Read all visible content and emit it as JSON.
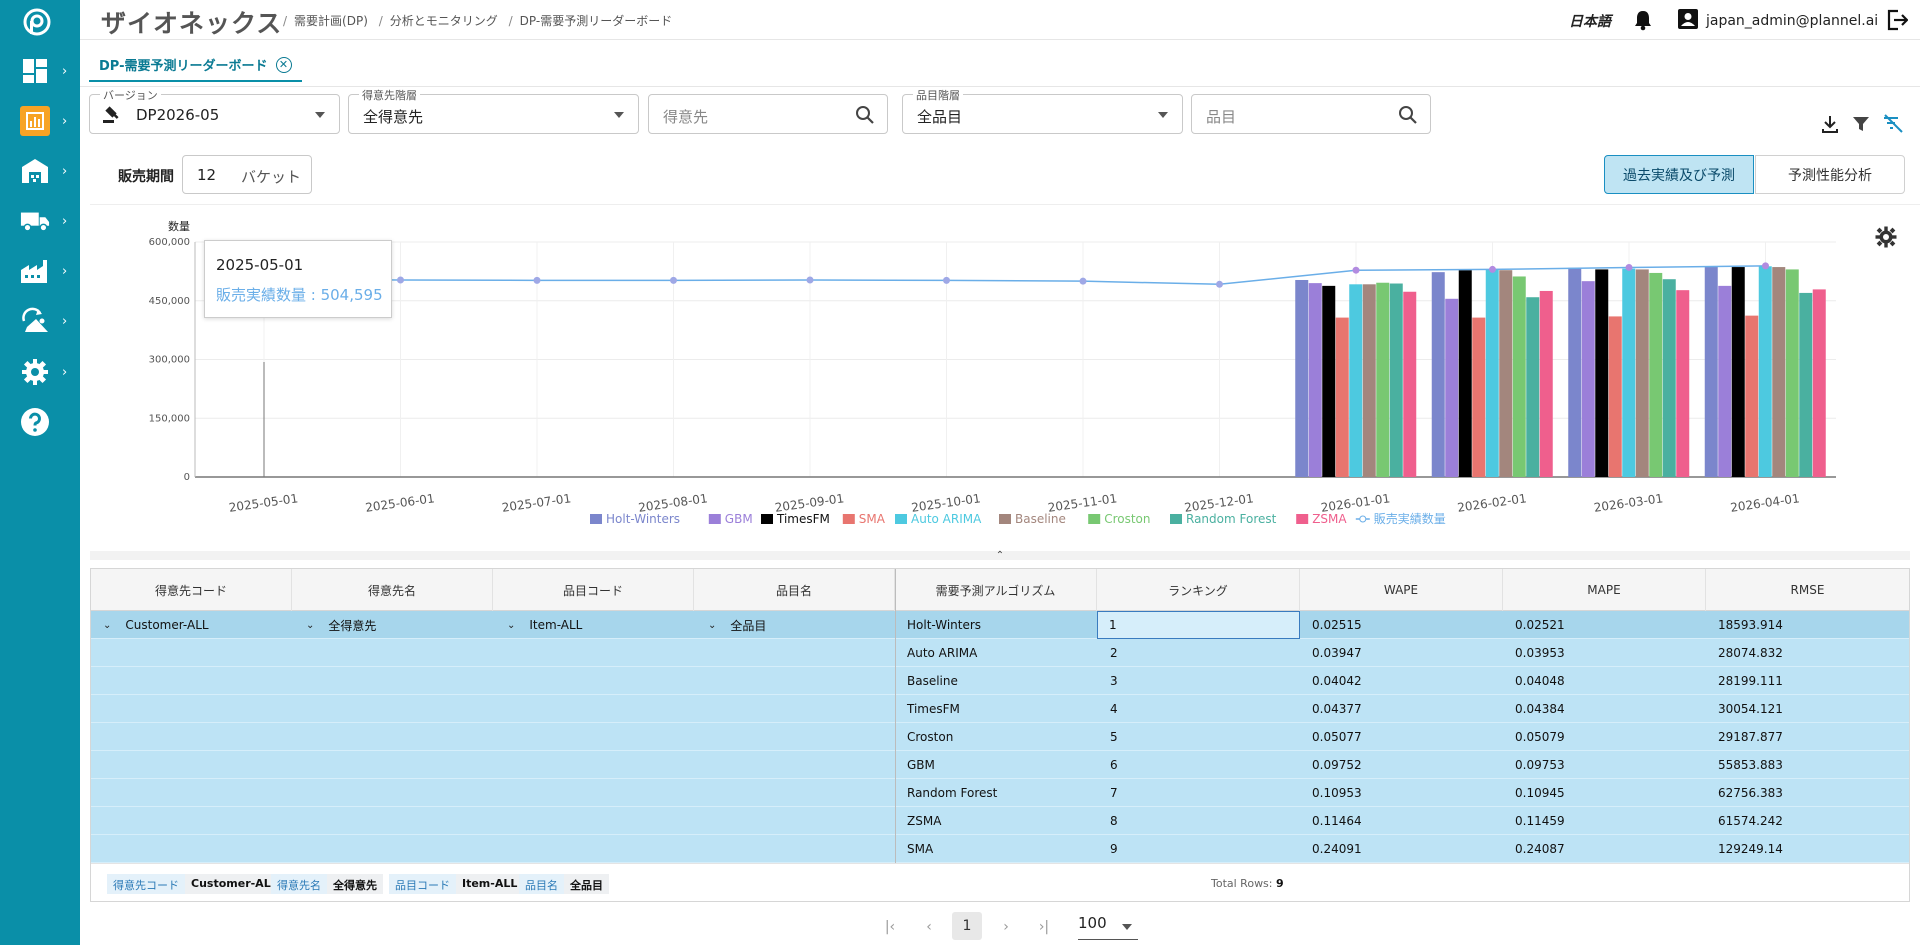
{
  "app": {
    "brand": "ザイオネックス",
    "breadcrumbs": [
      "需要計画(DP)",
      "分析とモニタリング",
      "DP-需要予測リーダーボード"
    ],
    "language": "日本語",
    "user_email": "japan_admin@plannel.ai"
  },
  "tab": {
    "label": "DP-需要予測リーダーボード"
  },
  "filters": {
    "version": {
      "label": "バージョン",
      "value": "DP2026-05"
    },
    "customer_level": {
      "label": "得意先階層",
      "value": "全得意先"
    },
    "customer_search": {
      "placeholder": "得意先"
    },
    "item_level": {
      "label": "品目階層",
      "value": "全品目"
    },
    "item_search": {
      "placeholder": "品目"
    }
  },
  "period": {
    "label": "販売期間",
    "value": "12",
    "unit": "バケット"
  },
  "toggles": {
    "history": "過去実績及び予測",
    "performance": "予測性能分析"
  },
  "tooltip": {
    "date": "2025-05-01",
    "label": "販売実績数量 : 504,595"
  },
  "colors": {
    "sidebar": "#0a8fa8",
    "active_nav": "#f7a325",
    "row_selected": "#a7d6ec",
    "row": "#bde3f5",
    "toggle_on": "#bfe4f3"
  },
  "chart_data": {
    "type": "bar",
    "ylabel": "数量",
    "ylim": [
      0,
      600000
    ],
    "yticks": [
      "0",
      "150,000",
      "300,000",
      "450,000",
      "600,000"
    ],
    "x": [
      "2025-05-01",
      "2025-06-01",
      "2025-07-01",
      "2025-08-01",
      "2025-09-01",
      "2025-10-01",
      "2025-11-01",
      "2025-12-01",
      "2026-01-01",
      "2026-02-01",
      "2026-03-01",
      "2026-04-01"
    ],
    "series": [
      {
        "name": "Holt-Winters",
        "color": "#7b86cc",
        "values": [
          null,
          null,
          null,
          null,
          null,
          null,
          null,
          null,
          503000,
          523000,
          534000,
          538000
        ]
      },
      {
        "name": "GBM",
        "color": "#9b7fd9",
        "values": [
          null,
          null,
          null,
          null,
          null,
          null,
          null,
          null,
          495000,
          455000,
          500000,
          488000
        ]
      },
      {
        "name": "TimesFM",
        "color": "#000000",
        "values": [
          null,
          null,
          null,
          null,
          null,
          null,
          null,
          null,
          488000,
          528000,
          530000,
          536000
        ]
      },
      {
        "name": "SMA",
        "color": "#e8756f",
        "values": [
          null,
          null,
          null,
          null,
          null,
          null,
          null,
          null,
          407000,
          407000,
          410000,
          412000
        ]
      },
      {
        "name": "Auto ARIMA",
        "color": "#4dc9e0",
        "values": [
          null,
          null,
          null,
          null,
          null,
          null,
          null,
          null,
          492000,
          530000,
          532000,
          538000
        ]
      },
      {
        "name": "Baseline",
        "color": "#a3867d",
        "values": [
          null,
          null,
          null,
          null,
          null,
          null,
          null,
          null,
          492000,
          528000,
          530000,
          536000
        ]
      },
      {
        "name": "Croston",
        "color": "#78c872",
        "values": [
          null,
          null,
          null,
          null,
          null,
          null,
          null,
          null,
          496000,
          512000,
          521000,
          530000
        ]
      },
      {
        "name": "Random Forest",
        "color": "#4ab0a0",
        "values": [
          null,
          null,
          null,
          null,
          null,
          null,
          null,
          null,
          494000,
          459000,
          505000,
          470000
        ]
      },
      {
        "name": "ZSMA",
        "color": "#ef5f8d",
        "values": [
          null,
          null,
          null,
          null,
          null,
          null,
          null,
          null,
          473000,
          475000,
          477000,
          479000
        ]
      }
    ],
    "line": {
      "name": "販売実績数量",
      "color": "#6aaee8",
      "values": [
        504595,
        503000,
        502000,
        502000,
        503000,
        502000,
        500000,
        492000,
        528000,
        530000,
        535000,
        539000
      ]
    }
  },
  "table": {
    "headers": [
      "得意先コード",
      "得意先名",
      "品目コード",
      "品目名",
      "需要予測アルゴリズム",
      "ランキング",
      "WAPE",
      "MAPE",
      "RMSE"
    ],
    "group": {
      "customer_code": "Customer-ALL",
      "customer_name": "全得意先",
      "item_code": "Item-ALL",
      "item_name": "全品目"
    },
    "rows": [
      {
        "algo": "Holt-Winters",
        "rank": "1",
        "wape": "0.02515",
        "mape": "0.02521",
        "rmse": "18593.914"
      },
      {
        "algo": "Auto ARIMA",
        "rank": "2",
        "wape": "0.03947",
        "mape": "0.03953",
        "rmse": "28074.832"
      },
      {
        "algo": "Baseline",
        "rank": "3",
        "wape": "0.04042",
        "mape": "0.04048",
        "rmse": "28199.111"
      },
      {
        "algo": "TimesFM",
        "rank": "4",
        "wape": "0.04377",
        "mape": "0.04384",
        "rmse": "30054.121"
      },
      {
        "algo": "Croston",
        "rank": "5",
        "wape": "0.05077",
        "mape": "0.05079",
        "rmse": "29187.877"
      },
      {
        "algo": "GBM",
        "rank": "6",
        "wape": "0.09752",
        "mape": "0.09753",
        "rmse": "55853.883"
      },
      {
        "algo": "Random Forest",
        "rank": "7",
        "wape": "0.10953",
        "mape": "0.10945",
        "rmse": "62756.383"
      },
      {
        "algo": "ZSMA",
        "rank": "8",
        "wape": "0.11464",
        "mape": "0.11459",
        "rmse": "61574.242"
      },
      {
        "algo": "SMA",
        "rank": "9",
        "wape": "0.24091",
        "mape": "0.24087",
        "rmse": "129249.14"
      }
    ],
    "filter_chips": [
      {
        "key": "得意先コード",
        "value": "Customer-ALL"
      },
      {
        "key": "得意先名",
        "value": "全得意先"
      },
      {
        "key": "品目コード",
        "value": "Item-ALL"
      },
      {
        "key": "品目名",
        "value": "全品目"
      }
    ],
    "total_label": "Total Rows:",
    "total_value": "9"
  },
  "pager": {
    "current": "1",
    "page_size": "100"
  }
}
